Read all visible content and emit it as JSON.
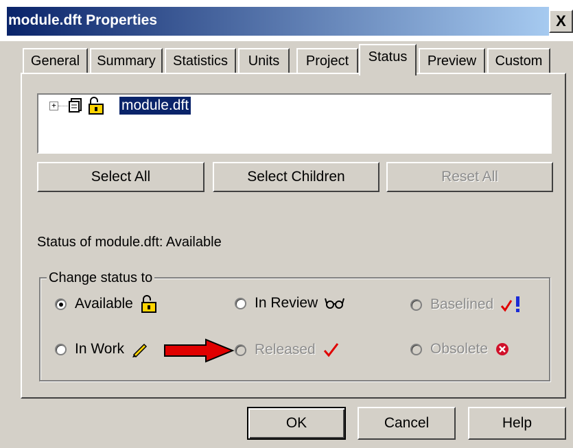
{
  "window": {
    "title": "module.dft Properties",
    "close_label": "X"
  },
  "tabs": [
    {
      "label": "General"
    },
    {
      "label": "Summary"
    },
    {
      "label": "Statistics"
    },
    {
      "label": "Units"
    },
    {
      "label": "Project"
    },
    {
      "label": "Status",
      "active": true
    },
    {
      "label": "Preview"
    },
    {
      "label": "Custom"
    }
  ],
  "tree": {
    "expander": "+",
    "item_label": "module.dft"
  },
  "buttons": {
    "select_all": "Select All",
    "select_children": "Select Children",
    "reset_all": "Reset All"
  },
  "status_line": "Status of  module.dft:  Available",
  "group": {
    "label": "Change status to",
    "options": [
      {
        "label": "Available",
        "checked": true,
        "enabled": true,
        "icon": "padlock-icon"
      },
      {
        "label": "In Review",
        "checked": false,
        "enabled": true,
        "icon": "glasses-icon"
      },
      {
        "label": "Baselined",
        "checked": false,
        "enabled": false,
        "icon": "check-exclamation-icon"
      },
      {
        "label": "In Work",
        "checked": false,
        "enabled": true,
        "icon": "pencil-icon"
      },
      {
        "label": "Released",
        "checked": false,
        "enabled": false,
        "icon": "red-check-icon"
      },
      {
        "label": "Obsolete",
        "checked": false,
        "enabled": false,
        "icon": "red-x-icon"
      }
    ]
  },
  "footer": {
    "ok": "OK",
    "cancel": "Cancel",
    "help": "Help"
  },
  "colors": {
    "dialog_face": "#d4d0c8",
    "title_start": "#0a246a",
    "title_end": "#a6caf0",
    "selection": "#0a246a",
    "arrow_red": "#e00000"
  }
}
